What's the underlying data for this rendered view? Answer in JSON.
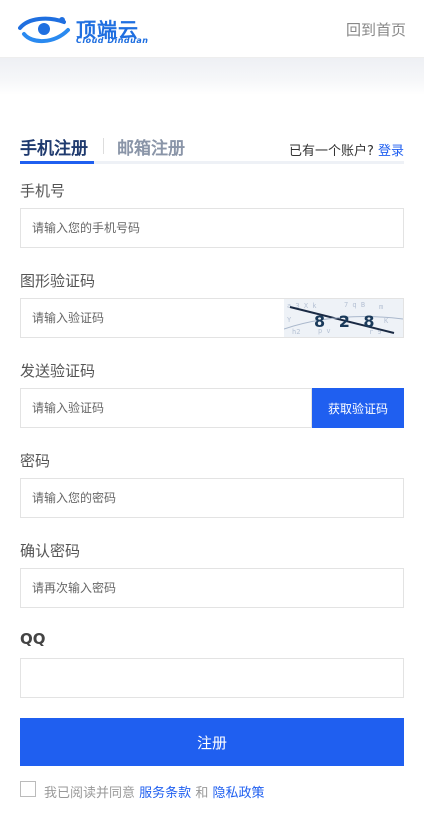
{
  "header": {
    "logo_cn": "顶端云",
    "logo_en": "Cloud Dinduan",
    "home_link": "回到首页"
  },
  "tabs": {
    "phone": "手机注册",
    "email": "邮箱注册",
    "have_account": "已有一个账户?",
    "login": "登录"
  },
  "form": {
    "phone_label": "手机号",
    "phone_placeholder": "请输入您的手机号码",
    "captcha_label": "图形验证码",
    "captcha_placeholder": "请输入验证码",
    "captcha_text": "8 2 8",
    "sms_label": "发送验证码",
    "sms_placeholder": "请输入验证码",
    "sms_button": "获取验证码",
    "password_label": "密码",
    "password_placeholder": "请输入您的密码",
    "confirm_label": "确认密码",
    "confirm_placeholder": "请再次输入密码",
    "qq_label": "QQ",
    "qq_value": "",
    "submit": "注册"
  },
  "agreement": {
    "prefix": "我已阅读并同意",
    "terms": "服务条款",
    "and": "和",
    "privacy": "隐私政策",
    "checked": false
  },
  "colors": {
    "accent": "#1f5ff0",
    "logo": "#1f6fe0"
  }
}
